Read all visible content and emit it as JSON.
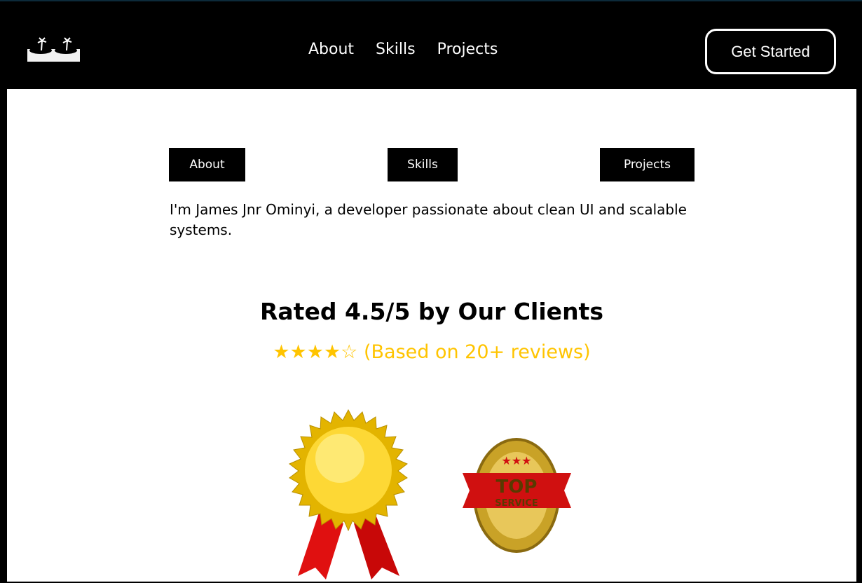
{
  "nav": {
    "links": [
      "About",
      "Skills",
      "Projects"
    ],
    "cta": "Get Started"
  },
  "sections": {
    "buttons": [
      "About",
      "Skills",
      "Projects"
    ],
    "bio": "I'm James Jnr Ominyi, a developer passionate about clean UI and scalable systems."
  },
  "rating": {
    "title": "Rated 4.5/5 by Our Clients",
    "stars": "★★★★☆",
    "reviews": "(Based on 20+ reviews)",
    "color": "#ffc400"
  },
  "badges": {
    "top_service": {
      "line1": "TOP",
      "line2": "SERVICE"
    }
  }
}
